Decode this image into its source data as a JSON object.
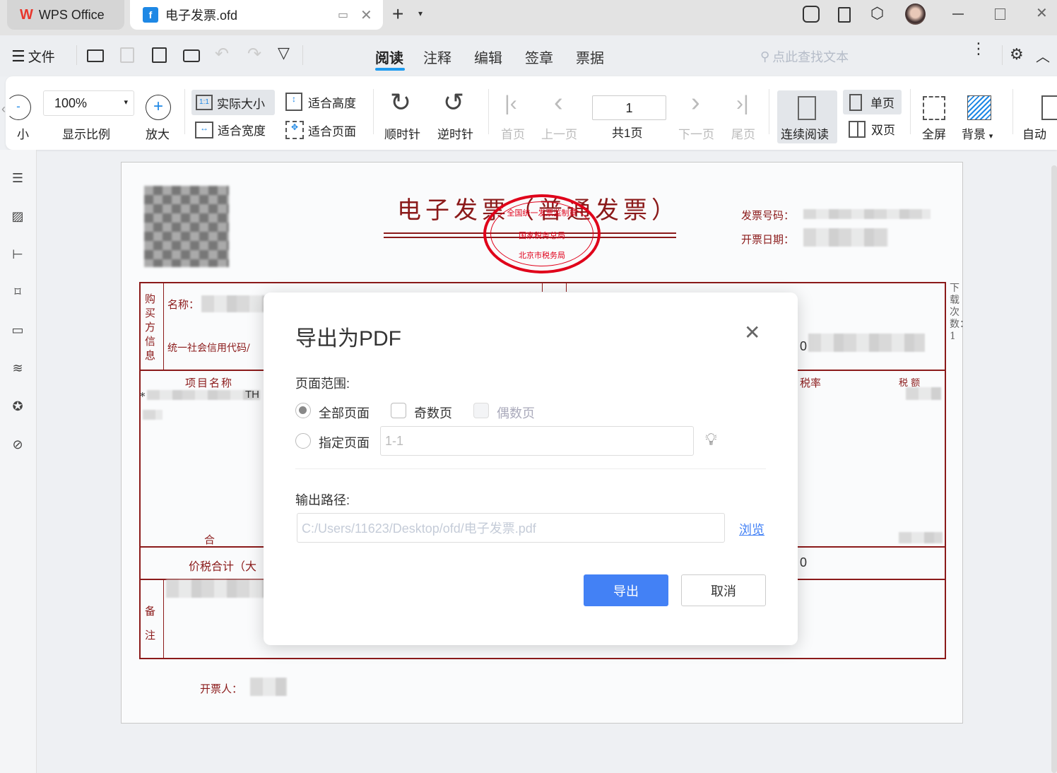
{
  "tabs": {
    "home": "WPS Office",
    "doc": "电子发票.ofd"
  },
  "menu": {
    "file": "文件",
    "tabs": [
      "阅读",
      "注释",
      "编辑",
      "签章",
      "票据"
    ],
    "search_placeholder": "点此查找文本"
  },
  "ribbon": {
    "zoom_out": "小",
    "zoom_value": "100%",
    "zoom_label": "显示比例",
    "zoom_in": "放大",
    "actual": "实际大小",
    "fit_height": "适合高度",
    "fit_width": "适合宽度",
    "fit_page": "适合页面",
    "cw": "顺时针",
    "ccw": "逆时针",
    "first": "首页",
    "prev": "上一页",
    "page_value": "1",
    "page_total": "共1页",
    "next": "下一页",
    "last": "尾页",
    "continuous": "连续阅读",
    "single": "单页",
    "double": "双页",
    "fullscreen": "全屏",
    "background": "背景",
    "auto": "自动"
  },
  "invoice": {
    "title": "电子发票（普通发票）",
    "stamp_top": "全国统一发票监制章",
    "stamp_mid": "国家税务总局",
    "stamp_bottom": "北京市税务局",
    "number_label": "发票号码：",
    "date_label": "开票日期：",
    "buyer_label": "购买方信息",
    "name_label": "名称：",
    "credit_label": "统一社会信用代码/",
    "item_label": "项目名称",
    "tax_rate": "税率",
    "tax_amount": "税 额",
    "total_char": "合",
    "total_words": "价税合计（大",
    "remarks_label": "备注",
    "issuer_label": "开票人：",
    "download_count": "下载次数：1",
    "partial_item": "*",
    "partial_it": "TH",
    "zero1": "0",
    "zero2": "0"
  },
  "dialog": {
    "title": "导出为PDF",
    "range_label": "页面范围:",
    "all_pages": "全部页面",
    "odd_pages": "奇数页",
    "even_pages": "偶数页",
    "specific_pages": "指定页面",
    "pages_placeholder": "1-1",
    "output_label": "输出路径:",
    "output_path": "C:/Users/11623/Desktop/ofd/电子发票.pdf",
    "browse": "浏览",
    "export": "导出",
    "cancel": "取消"
  },
  "colors": {
    "accent": "#4381f5",
    "invoice_red": "#8b1a1a",
    "stamp": "#e0001a"
  }
}
